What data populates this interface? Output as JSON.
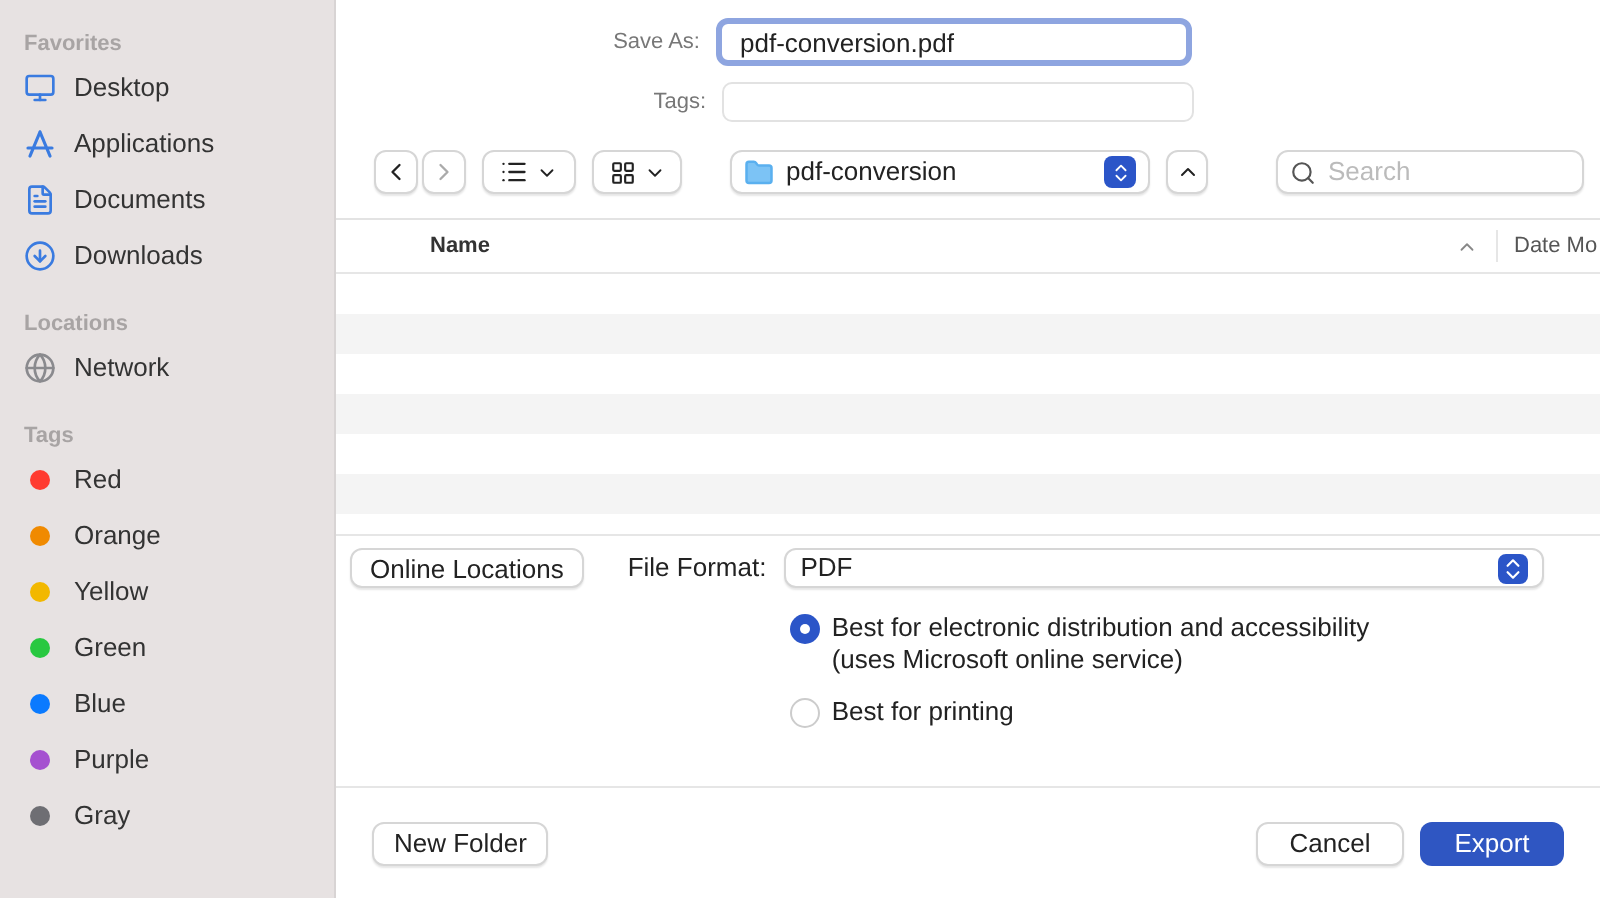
{
  "sidebar": {
    "sections": [
      {
        "title": "Favorites",
        "items": [
          {
            "label": "Desktop",
            "kind": "desktop"
          },
          {
            "label": "Applications",
            "kind": "apps"
          },
          {
            "label": "Documents",
            "kind": "doc"
          },
          {
            "label": "Downloads",
            "kind": "download"
          }
        ]
      },
      {
        "title": "Locations",
        "items": [
          {
            "label": "Network",
            "kind": "globe"
          }
        ]
      },
      {
        "title": "Tags",
        "items": [
          {
            "label": "Red",
            "kind": "tag",
            "color": "#ff3b30"
          },
          {
            "label": "Orange",
            "kind": "tag",
            "color": "#f08a00"
          },
          {
            "label": "Yellow",
            "kind": "tag",
            "color": "#f2b800"
          },
          {
            "label": "Green",
            "kind": "tag",
            "color": "#28c840"
          },
          {
            "label": "Blue",
            "kind": "tag",
            "color": "#0a7aff"
          },
          {
            "label": "Purple",
            "kind": "tag",
            "color": "#a550d0"
          },
          {
            "label": "Gray",
            "kind": "tag",
            "color": "#6e6e73"
          }
        ]
      }
    ]
  },
  "save_as": {
    "label": "Save As:",
    "value": "pdf-conversion.pdf"
  },
  "tags": {
    "label": "Tags:"
  },
  "toolbar": {
    "folder": "pdf-conversion",
    "search_placeholder": "Search"
  },
  "table": {
    "columns": [
      "Name",
      "Date Mo"
    ]
  },
  "online_locations": "Online Locations",
  "file_format": {
    "label": "File Format:",
    "value": "PDF"
  },
  "options": [
    {
      "label": "Best for electronic distribution and accessibility\n(uses Microsoft online service)",
      "selected": true
    },
    {
      "label": "Best for printing",
      "selected": false
    }
  ],
  "buttons": {
    "new_folder": "New Folder",
    "cancel": "Cancel",
    "export": "Export"
  }
}
